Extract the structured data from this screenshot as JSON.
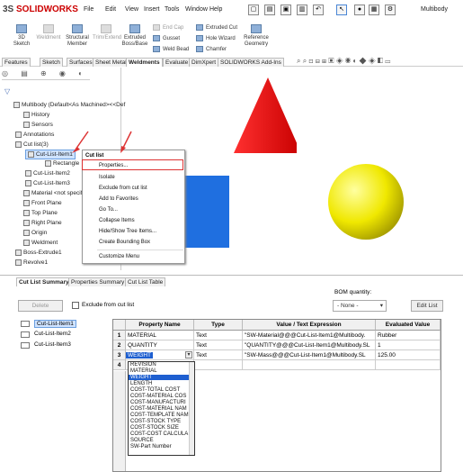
{
  "app": {
    "logo_prefix": "3S",
    "logo_name": "SOLIDWORKS",
    "doc": "Multibody"
  },
  "menu": [
    "File",
    "Edit",
    "View",
    "Insert",
    "Tools",
    "Window",
    "Help"
  ],
  "ribbon": {
    "big": [
      {
        "label": "3D\nSketch",
        "dis": false
      },
      {
        "label": "Weldment",
        "dis": true
      },
      {
        "label": "Structural\nMember",
        "dis": false
      },
      {
        "label": "Trim/Extend",
        "dis": true
      },
      {
        "label": "Extruded\nBoss/Base",
        "dis": false
      },
      {
        "label": "Reference\nGeometry",
        "dis": false
      }
    ],
    "small": [
      {
        "label": "End Cap",
        "dis": true
      },
      {
        "label": "Gusset",
        "dis": false
      },
      {
        "label": "Weld Bead",
        "dis": false
      },
      {
        "label": "Extruded Cut",
        "dis": false
      },
      {
        "label": "Hole Wizard",
        "dis": false
      },
      {
        "label": "Chamfer",
        "dis": false
      }
    ]
  },
  "tabs": [
    "Features",
    "Sketch",
    "Surfaces",
    "Sheet Metal",
    "Weldments",
    "Evaluate",
    "DimXpert",
    "SOLIDWORKS Add-Ins"
  ],
  "active_tab": "Weldments",
  "tree": {
    "root": "Multibody (Default<As Machined><<Def",
    "items": [
      "History",
      "Sensors",
      "Annotations",
      "Cut list(3)",
      "Cut-List-Item1",
      "Rectangle",
      "Cut-List-Item2",
      "Cut-List-Item3",
      "Material <not specif",
      "Front Plane",
      "Top Plane",
      "Right Plane",
      "Origin",
      "Weldment",
      "Boss-Extrude1",
      "Revolve1"
    ]
  },
  "context_menu": {
    "title": "Cut list",
    "items": [
      "Properties...",
      "Isolate",
      "Exclude from cut list",
      "Add to Favorites",
      "Go To...",
      "Collapse Items",
      "Hide/Show Tree Items...",
      "Create Bounding Box",
      "Customize Menu"
    ]
  },
  "panel": {
    "tabs": [
      "Cut List Summary",
      "Properties Summary",
      "Cut List Table"
    ],
    "delete_label": "Delete",
    "exclude_label": "Exclude from cut list",
    "bom_label": "BOM quantity:",
    "bom_value": "- None -",
    "edit_list_label": "Edit List",
    "list": [
      "Cut-List-Item1",
      "Cut-List-Item2",
      "Cut-List-Item3"
    ],
    "columns": [
      "Property Name",
      "Type",
      "Value / Text Expression",
      "Evaluated Value"
    ],
    "rows": [
      {
        "n": "1",
        "name": "MATERIAL",
        "type": "Text",
        "expr": "\"SW-Material@@@Cut-List-Item1@Multibody.",
        "val": "Rubber"
      },
      {
        "n": "2",
        "name": "QUANTITY",
        "type": "Text",
        "expr": "\"QUANTITY@@@Cut-List-Item1@Multibody.SL",
        "val": "1"
      },
      {
        "n": "3",
        "name": "WEIGHT",
        "type": "Text",
        "expr": "\"SW-Mass@@@Cut-List-Item1@Multibody.SL",
        "val": "125.00"
      },
      {
        "n": "4",
        "name": "",
        "type": "",
        "expr": "",
        "val": ""
      }
    ],
    "dropdown": [
      "REVISION",
      "MATERIAL",
      "WEIGHT",
      "LENGTH",
      "COST-TOTAL COST",
      "COST-MATERIAL COS",
      "COST-MANUFACTURI",
      "COST-MATERIAL NAM",
      "COST-TEMPLATE NAM",
      "COST-STOCK TYPE",
      "COST-STOCK SIZE",
      "COST-COST CALCULA",
      "SOURCE",
      "SW-Part Number"
    ],
    "dropdown_selected": "WEIGHT"
  },
  "colors": {
    "cone": "#ff0000",
    "sphere": "#f0e800",
    "box": "#1f6fe0",
    "accent": "#d33",
    "selection": "#cfe3ff"
  }
}
